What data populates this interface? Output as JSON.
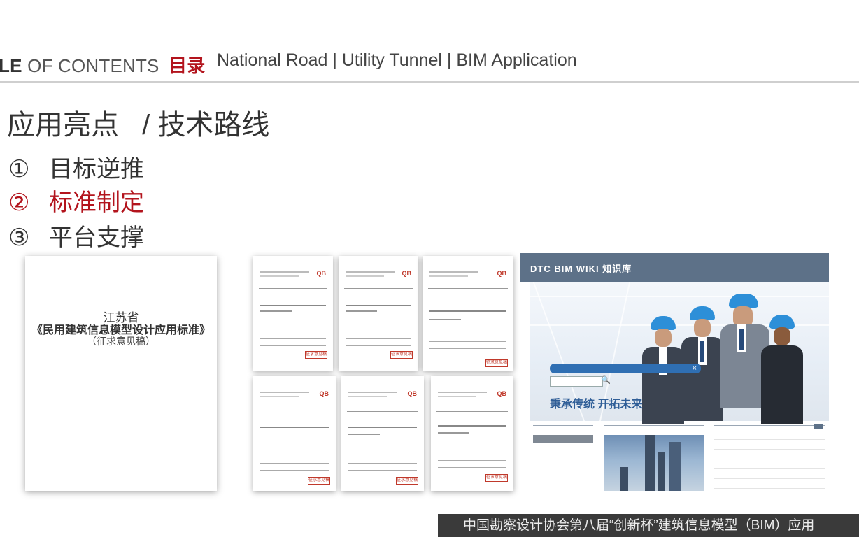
{
  "header": {
    "toc_prefix": "LE",
    "toc_rest": "OF CONTENTS",
    "toc_cn": "目录",
    "breadcrumb": "National Road | Utility Tunnel | BIM Application"
  },
  "section": {
    "title_left": "应用亮点",
    "title_right": "/ 技术路线"
  },
  "steps": [
    {
      "num": "①",
      "text": "目标逆推",
      "active": false
    },
    {
      "num": "②",
      "text": "标准制定",
      "active": true
    },
    {
      "num": "③",
      "text": "平台支撑",
      "active": false
    }
  ],
  "standard_doc": {
    "line1": "江苏省",
    "line2": "《民用建筑信息模型设计应用标准》",
    "line3": "（征求意见稿）"
  },
  "thumbnails": {
    "qb_mark": "QB",
    "docs": [
      {
        "stamp": "征求意见稿"
      },
      {
        "stamp": "征求意见稿"
      },
      {
        "stamp": "征求意见稿"
      },
      {
        "stamp": "征求意见稿"
      },
      {
        "stamp": "征求意见稿"
      },
      {
        "stamp": "征求意见稿"
      }
    ]
  },
  "wiki": {
    "brand": "DTC BIM WIKI 知识库",
    "tagline": "秉承传统  开拓未来",
    "close_glyph": "×",
    "search_glyph": "🔍"
  },
  "colors": {
    "accent_red": "#b3141d",
    "wiki_bar": "#5d7188",
    "footer_bg": "#3a3a3a"
  },
  "footer": {
    "text": "中国勘察设计协会第八届“创新杯”建筑信息模型（BIM）应用"
  }
}
